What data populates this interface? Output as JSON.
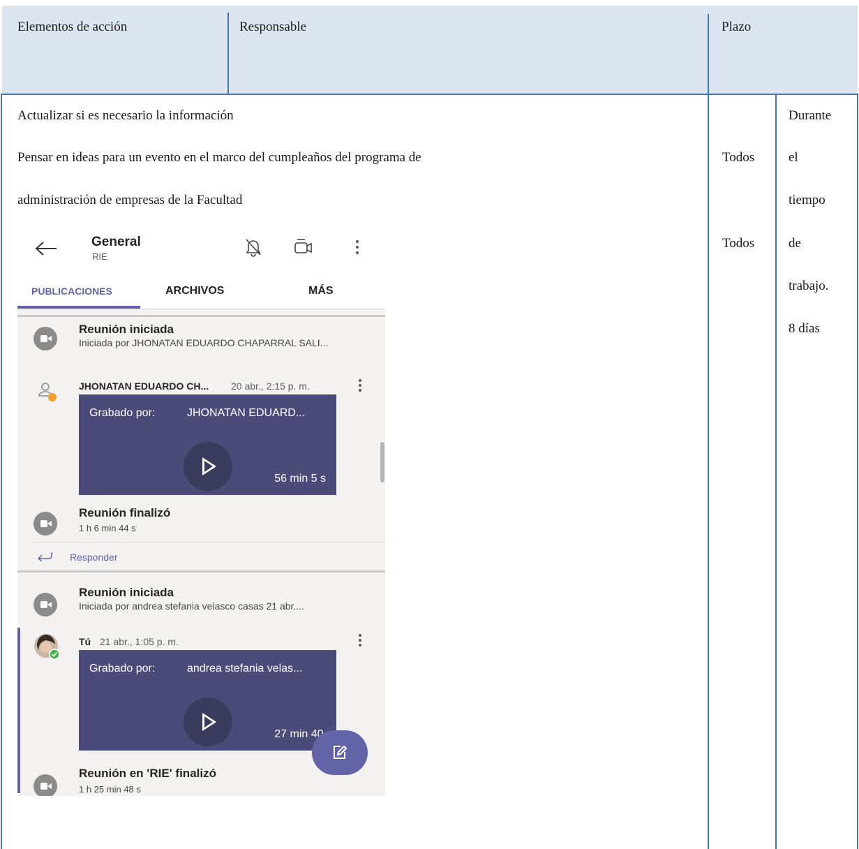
{
  "table": {
    "headers": [
      "Elementos de acción",
      "Responsable",
      "Plazo"
    ],
    "action_items": [
      "Actualizar si es necesario la información",
      "Pensar en ideas para un evento en el marco del cumpleaños del programa de",
      "administración de empresas de la Facultad"
    ],
    "responsables": [
      "Todos",
      "Todos"
    ],
    "plazo_lines": [
      "Durante",
      "el",
      "tiempo",
      "de",
      "trabajo.",
      "8 días"
    ]
  },
  "teams": {
    "channel_title": "General",
    "channel_team": "RIE",
    "tabs": [
      "PUBLICACIONES",
      "ARCHIVOS",
      "MÁS"
    ],
    "active_tab": "PUBLICACIONES",
    "accent_color": "#6264a7",
    "posts": [
      {
        "event_title": "Reunión iniciada",
        "event_sub": "Iniciada por JHONATAN EDUARDO CHAPARRAL SALI...",
        "author": "JHONATAN EDUARDO CH...",
        "time": "20 abr., 2:15 p. m.",
        "rec_label": "Grabado por:",
        "rec_name": "JHONATAN EDUARD...",
        "duration": "56 min 5 s",
        "end_title": "Reunión finalizó",
        "end_sub": "1 h 6 min 44 s",
        "reply": "Responder"
      },
      {
        "event_title": "Reunión iniciada",
        "event_sub": "Iniciada por andrea stefania velasco casas   21 abr....",
        "author": "Tú",
        "time": "21 abr., 1:05 p. m.",
        "rec_label": "Grabado por:",
        "rec_name": "andrea stefania velas...",
        "duration": "27 min 40 s",
        "end_title": "Reunión en 'RIE' finalizó",
        "end_sub": "1 h 25 min 48 s"
      }
    ]
  }
}
